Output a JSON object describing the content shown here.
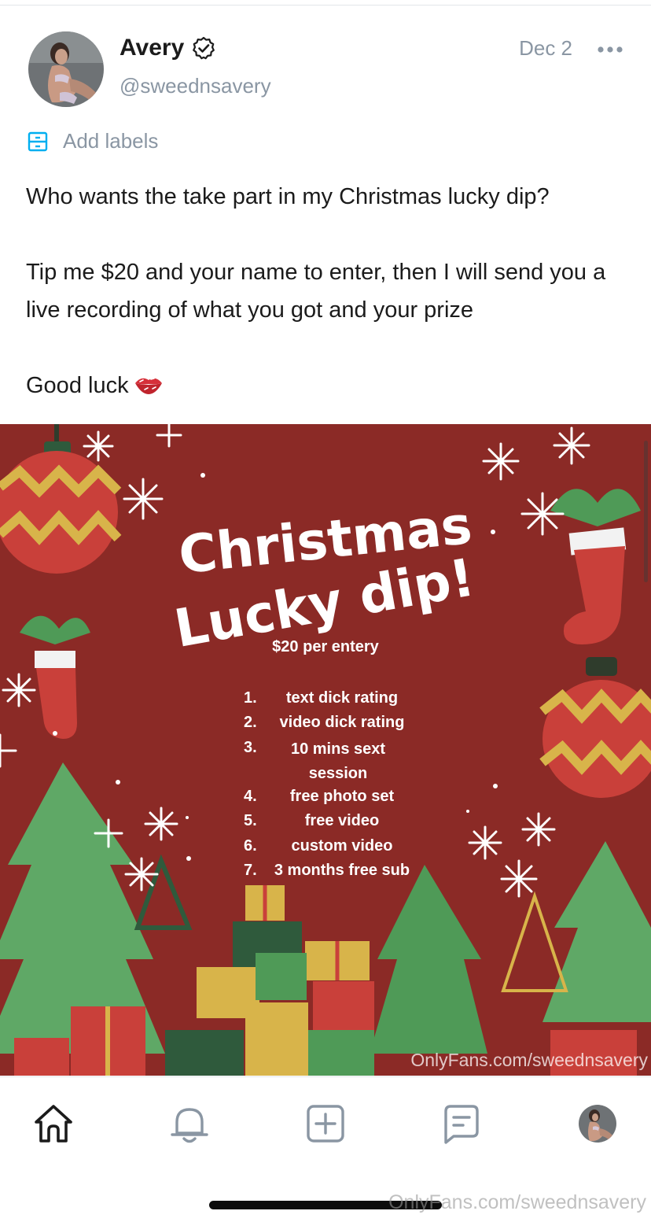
{
  "post": {
    "author": {
      "name": "Avery",
      "handle": "@sweednsavery",
      "verified_icon": "verified-badge-icon"
    },
    "date": "Dec 2",
    "more_icon": "more-dots-icon",
    "labels": {
      "icon": "tag-box-icon",
      "text": "Add labels"
    },
    "text": {
      "line1": "Who wants the take part in my Christmas lucky dip?",
      "line2": "Tip me $20 and your name to enter, then I will send you a live recording of what you got and your prize",
      "line3": "Good luck",
      "emoji_icon": "lips-kiss-icon"
    },
    "image": {
      "title_line1": "Christmas",
      "title_line2": "Lucky dip!",
      "price": "$20 per entery",
      "items": [
        {
          "num": "1.",
          "text": "text dick rating"
        },
        {
          "num": "2.",
          "text": "video dick rating"
        },
        {
          "num": "3.",
          "text": "10 mins sext session"
        },
        {
          "num": "4.",
          "text": "free photo set"
        },
        {
          "num": "5.",
          "text": "free video"
        },
        {
          "num": "6.",
          "text": "custom video"
        },
        {
          "num": "7.",
          "text": "3 months free sub"
        }
      ],
      "watermark": "OnlyFans.com/sweednsavery",
      "colors": {
        "background": "#8b2a26",
        "tree_green": "#5fa866",
        "ornament_red": "#c9403a",
        "gold": "#d8b44a"
      }
    }
  },
  "tab_bar": {
    "tabs": [
      {
        "icon": "home-icon"
      },
      {
        "icon": "bell-icon"
      },
      {
        "icon": "plus-square-icon"
      },
      {
        "icon": "message-icon"
      },
      {
        "icon": "profile-avatar"
      }
    ]
  },
  "page_watermark": "OnlyFans.com/sweednsavery",
  "accent_color": "#00aff0"
}
